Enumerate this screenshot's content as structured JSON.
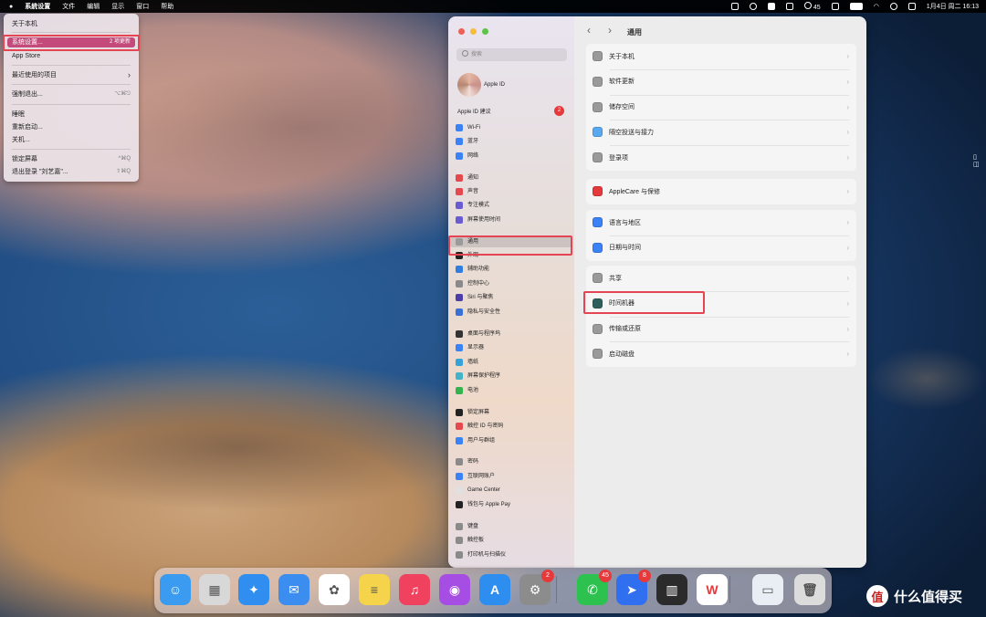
{
  "menubar": {
    "items": [
      "系統设置",
      "文件",
      "编辑",
      "显示",
      "窗口",
      "帮助"
    ],
    "status": {
      "wechat_count": "45",
      "datetime": "1月4日 周二 16:13"
    }
  },
  "apple_menu": {
    "items": [
      {
        "label": "关于本机",
        "shortcut": ""
      },
      {
        "label": "系统设置...",
        "shortcut": "2 项更新"
      },
      {
        "label": "App Store",
        "shortcut": ""
      },
      {
        "label": "最近使用的项目",
        "shortcut": "›"
      },
      {
        "label": "强制退出...",
        "shortcut": "⌥⌘⎋"
      },
      {
        "label": "睡眠",
        "shortcut": ""
      },
      {
        "label": "重新启动...",
        "shortcut": ""
      },
      {
        "label": "关机...",
        "shortcut": ""
      },
      {
        "label": "锁定屏幕",
        "shortcut": "^⌘Q"
      },
      {
        "label": "退出登录 \"刘艺嘉\"...",
        "shortcut": "⇧⌘Q"
      }
    ]
  },
  "settings": {
    "search_placeholder": "搜索",
    "account_label": "Apple ID",
    "suggestions_label": "Apple ID 建议",
    "suggestions_badge": "2",
    "sidebar_items": [
      {
        "label": "Wi-Fi",
        "color": "#3b82f6"
      },
      {
        "label": "蓝牙",
        "color": "#3b82f6"
      },
      {
        "label": "网络",
        "color": "#3b82f6"
      },
      {
        "label": "通知",
        "color": "#e5484d"
      },
      {
        "label": "声音",
        "color": "#e5484d"
      },
      {
        "label": "专注模式",
        "color": "#6b5bd2"
      },
      {
        "label": "屏幕使用时间",
        "color": "#6b5bd2"
      },
      {
        "label": "通用",
        "color": "#9a9a9a"
      },
      {
        "label": "外观",
        "color": "#222222"
      },
      {
        "label": "辅助功能",
        "color": "#2f7de1"
      },
      {
        "label": "控制中心",
        "color": "#8a8a8a"
      },
      {
        "label": "Siri 与聚焦",
        "color": "#4a3ea8"
      },
      {
        "label": "隐私与安全性",
        "color": "#3b6fd8"
      },
      {
        "label": "桌面与程序坞",
        "color": "#333333"
      },
      {
        "label": "显示器",
        "color": "#3b82f6"
      },
      {
        "label": "墙纸",
        "color": "#35a3d8"
      },
      {
        "label": "屏幕保护程序",
        "color": "#44b3c9"
      },
      {
        "label": "电池",
        "color": "#33b34d"
      },
      {
        "label": "锁定屏幕",
        "color": "#222222"
      },
      {
        "label": "触控 ID 与密码",
        "color": "#e5484d"
      },
      {
        "label": "用户与群组",
        "color": "#3b82f6"
      },
      {
        "label": "密码",
        "color": "#8a8a8a"
      },
      {
        "label": "互联网账户",
        "color": "#3b82f6"
      },
      {
        "label": "Game Center",
        "color": "#e0e0e0"
      },
      {
        "label": "钱包与 Apple Pay",
        "color": "#222222"
      },
      {
        "label": "键盘",
        "color": "#8a8a8a"
      },
      {
        "label": "触控板",
        "color": "#8a8a8a"
      },
      {
        "label": "打印机与扫描仪",
        "color": "#8a8a8a"
      }
    ],
    "page_title": "通用",
    "groups": [
      {
        "rows": [
          {
            "label": "关于本机",
            "color": "#9a9a9a"
          },
          {
            "label": "软件更新",
            "color": "#9a9a9a"
          },
          {
            "label": "储存空间",
            "color": "#9a9a9a"
          },
          {
            "label": "隔空投送与接力",
            "color": "#5aa9f0"
          },
          {
            "label": "登录项",
            "color": "#9a9a9a"
          }
        ]
      },
      {
        "rows": [
          {
            "label": "AppleCare 与保修",
            "color": "#e5393c"
          }
        ]
      },
      {
        "rows": [
          {
            "label": "语言与地区",
            "color": "#3b82f6"
          },
          {
            "label": "日期与时间",
            "color": "#3b82f6"
          }
        ]
      },
      {
        "rows": [
          {
            "label": "共享",
            "color": "#9a9a9a"
          },
          {
            "label": "时间机器",
            "color": "#2f5f5a"
          },
          {
            "label": "传输或还原",
            "color": "#9a9a9a"
          },
          {
            "label": "启动磁盘",
            "color": "#9a9a9a"
          }
        ]
      }
    ]
  },
  "dock": {
    "apps": [
      {
        "name": "finder-icon",
        "color": "#3b9bf0",
        "glyph": "☺"
      },
      {
        "name": "launchpad-icon",
        "color": "#d8d8d8",
        "glyph": "▦"
      },
      {
        "name": "safari-icon",
        "color": "#2f8ef0",
        "glyph": "✦"
      },
      {
        "name": "mail-icon",
        "color": "#3b8df0",
        "glyph": "✉"
      },
      {
        "name": "photos-icon",
        "color": "#ffffff",
        "glyph": "✿"
      },
      {
        "name": "notes-icon",
        "color": "#f5d34a",
        "glyph": "≡"
      },
      {
        "name": "music-icon",
        "color": "#f0415e",
        "glyph": "♫"
      },
      {
        "name": "podcasts-icon",
        "color": "#a64ee3",
        "glyph": "◉"
      },
      {
        "name": "app-store-icon",
        "color": "#2e8ef0",
        "glyph": "A"
      },
      {
        "name": "system-settings-icon",
        "color": "#8c8c8c",
        "glyph": "⚙"
      },
      {
        "name": "wechat-icon",
        "color": "#2dc24f",
        "glyph": "✆"
      },
      {
        "name": "feishu-icon",
        "color": "#2f6ff0",
        "glyph": "➤"
      },
      {
        "name": "activity-monitor-icon",
        "color": "#2b2b2b",
        "glyph": "▥"
      },
      {
        "name": "wps-icon",
        "color": "#ffffff",
        "glyph": "W"
      },
      {
        "name": "preview-icon",
        "color": "#e8eef3",
        "glyph": "▭"
      },
      {
        "name": "trash-icon",
        "color": "#dcdcdc",
        "glyph": "🗑"
      }
    ],
    "badges": {
      "system_settings": "2",
      "wechat": "45",
      "feishu": "8"
    }
  },
  "watermark": {
    "logo": "值",
    "text": "什么值得买"
  }
}
